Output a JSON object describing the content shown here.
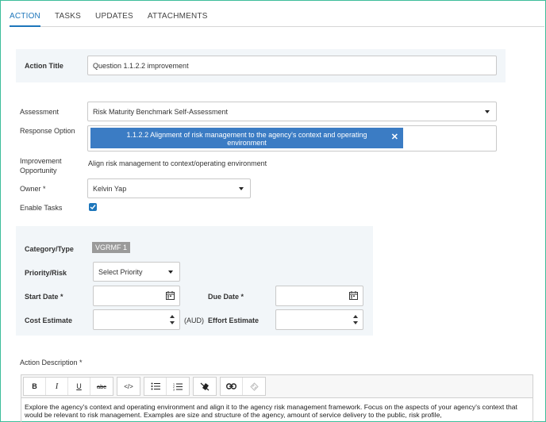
{
  "tabs": [
    {
      "label": "ACTION"
    },
    {
      "label": "TASKS"
    },
    {
      "label": "UPDATES"
    },
    {
      "label": "ATTACHMENTS"
    }
  ],
  "form": {
    "action_title_label": "Action Title",
    "action_title_value": "Question 1.1.2.2 improvement",
    "assessment_label": "Assessment",
    "assessment_value": "Risk Maturity Benchmark Self-Assessment",
    "response_option_label": "Response Option",
    "response_option_tag": "1.1.2.2 Alignment of risk management to the agency's context and operating environment",
    "improvement_label": "Improvement Opportunity",
    "improvement_value": "Align risk management to context/operating environment",
    "owner_label": "Owner *",
    "owner_value": "Kelvin Yap",
    "enable_tasks_label": "Enable Tasks",
    "enable_tasks_checked": true
  },
  "details": {
    "category_label": "Category/Type",
    "category_chip": "VGRMF 1",
    "priority_label": "Priority/Risk",
    "priority_value": "Select Priority",
    "start_date_label": "Start Date *",
    "due_date_label": "Due Date *",
    "cost_label": "Cost Estimate",
    "cost_unit": "(AUD)",
    "effort_label": "Effort Estimate"
  },
  "description": {
    "label": "Action Description *",
    "text": "Explore the agency's context and operating environment and align it to the agency risk management framework. Focus on the aspects of your agency's context that would be relevant to risk management. Examples are size and structure of the agency, amount of service delivery to the public, risk profile,"
  },
  "toolbar": {
    "bold": "B",
    "italic": "I",
    "underline": "U",
    "strike": "abc",
    "code": "</>"
  },
  "colors": {
    "accent": "#1d76bb",
    "tag": "#3b7cc4",
    "panel": "#f2f6f9",
    "frame": "#3dbd9a"
  }
}
